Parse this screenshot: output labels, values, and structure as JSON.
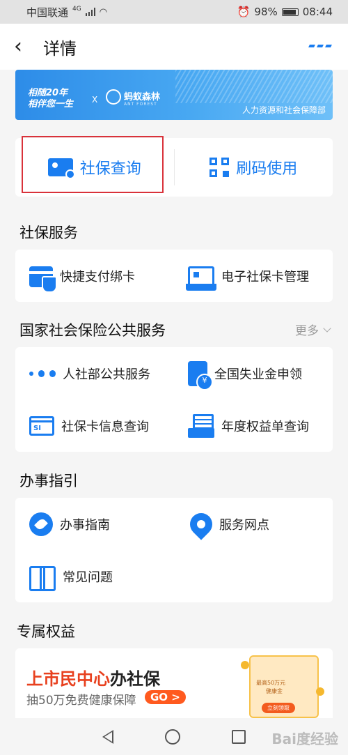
{
  "statusbar": {
    "carrier": "中国联通",
    "network": "4G",
    "battery": "98%",
    "time": "08:44"
  },
  "navbar": {
    "back_icon": "chevron-left-icon",
    "title": "详情",
    "more_icon": "more-dots-icon"
  },
  "banner": {
    "slogan_line1": "相随20年",
    "slogan_line2": "相伴您一生",
    "x": "X",
    "partner": "蚂蚁森林",
    "partner_sub": "ANT FOREST",
    "ministry": "人力资源和社会保障部"
  },
  "quick_actions": [
    {
      "label": "社保查询",
      "icon": "id-card-search-icon"
    },
    {
      "label": "刷码使用",
      "icon": "qr-code-icon"
    }
  ],
  "sections": {
    "social_security": {
      "title": "社保服务",
      "items": [
        {
          "label": "快捷支付绑卡",
          "icon": "card-shield-icon"
        },
        {
          "label": "电子社保卡管理",
          "icon": "e-card-tray-icon"
        }
      ]
    },
    "national": {
      "title": "国家社会保险公共服务",
      "more": "更多",
      "items": [
        {
          "label": "人社部公共服务",
          "icon": "three-dots-icon"
        },
        {
          "label": "全国失业金申领",
          "icon": "document-yuan-icon"
        },
        {
          "label": "社保卡信息查询",
          "icon": "si-card-icon"
        },
        {
          "label": "年度权益单查询",
          "icon": "envelope-list-icon"
        }
      ]
    },
    "guide": {
      "title": "办事指引",
      "items": [
        {
          "label": "办事指南",
          "icon": "compass-icon"
        },
        {
          "label": "服务网点",
          "icon": "location-pin-icon"
        },
        {
          "label": "常见问题",
          "icon": "open-book-icon"
        }
      ]
    },
    "benefits": {
      "title": "专属权益",
      "promo": {
        "title_highlight": "上市民中心",
        "title_rest": "办社保",
        "subtitle": "抽50万免费健康保障",
        "button": "GO >",
        "art_line1": "最高50万元",
        "art_line2": "健康金",
        "art_cta": "立刻领取"
      }
    }
  },
  "system_nav": {
    "back": "back-triangle-icon",
    "home": "home-circle-icon",
    "recent": "recent-square-icon"
  },
  "watermark": "Bai度经验",
  "colors": {
    "accent": "#1a7df0",
    "highlight_box": "#d9323a",
    "promo_orange": "#ff5a1f"
  }
}
